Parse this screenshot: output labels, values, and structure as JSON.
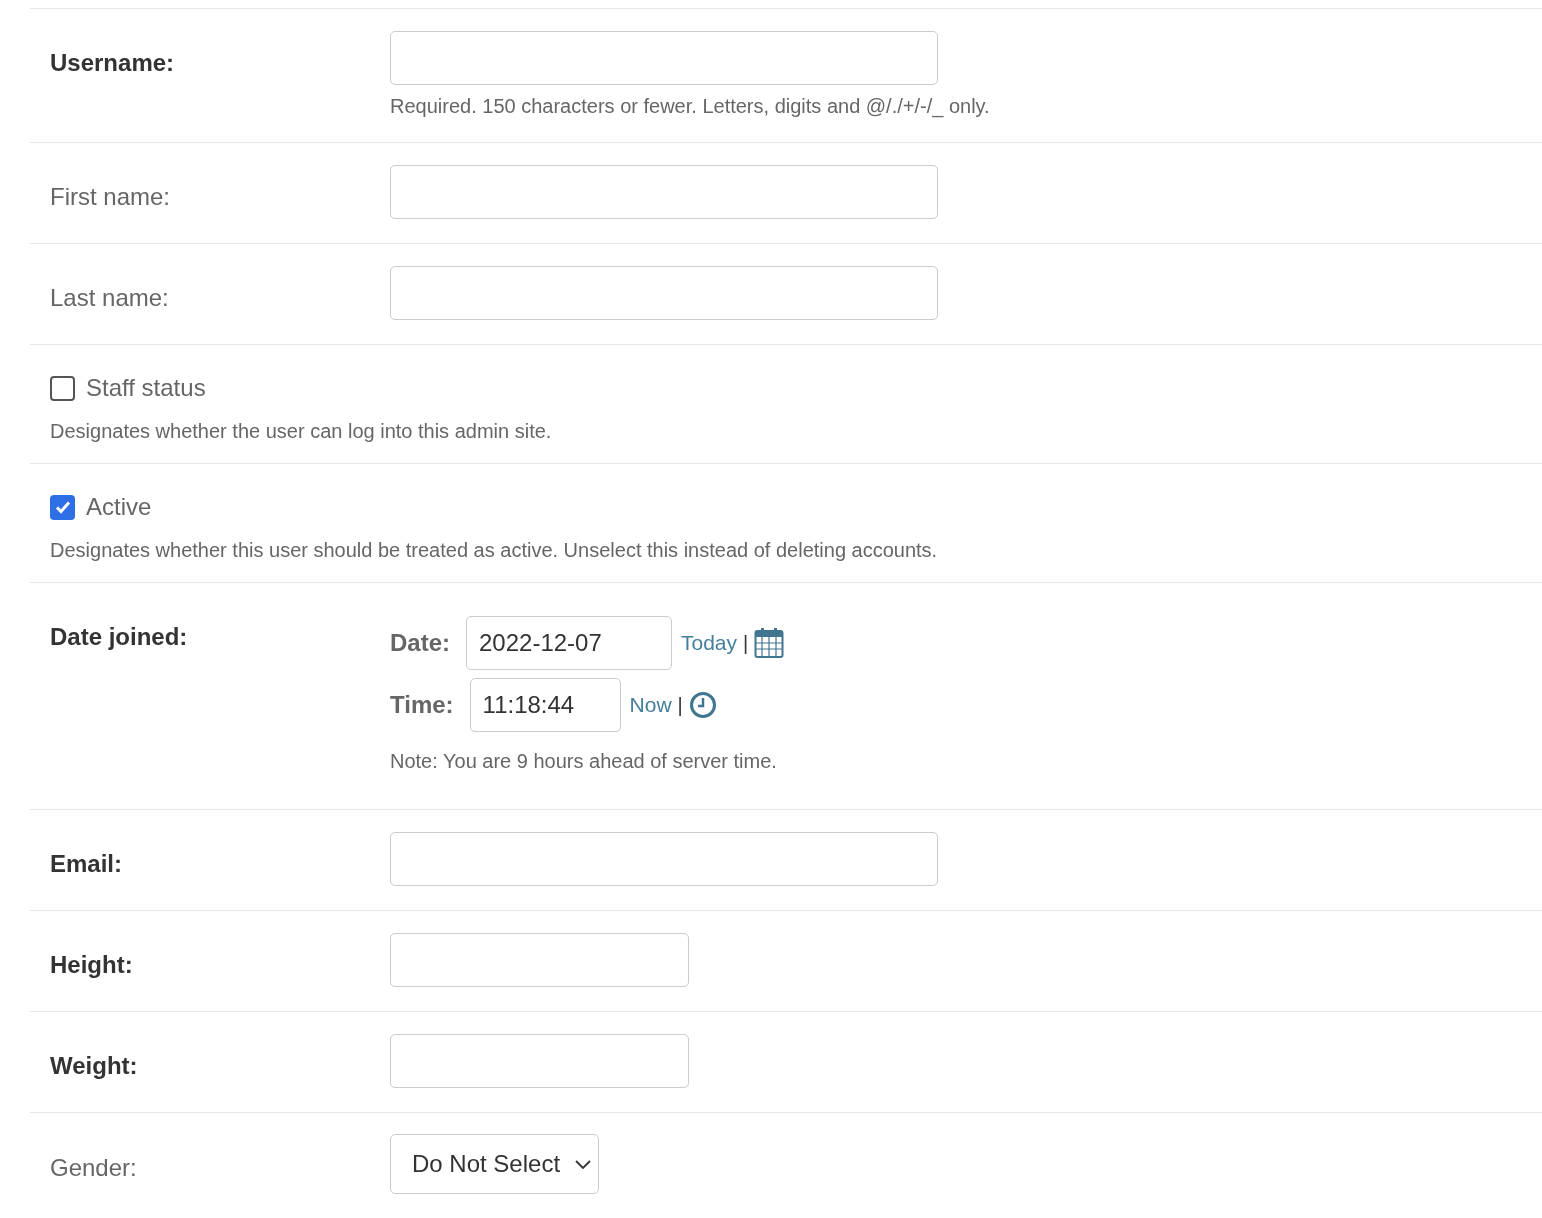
{
  "fields": [
    {
      "kind": "text",
      "label": "Username:",
      "required": true,
      "help": "Required. 150 characters or fewer. Letters, digits and @/./+/-/_ only."
    },
    {
      "kind": "text",
      "label": "First name:",
      "required": false
    },
    {
      "kind": "text",
      "label": "Last name:",
      "required": false
    },
    {
      "kind": "checkbox",
      "label": "Staff status",
      "checked": false,
      "help": "Designates whether the user can log into this admin site."
    },
    {
      "kind": "checkbox",
      "label": "Active",
      "checked": true,
      "help": "Designates whether this user should be treated as active. Unselect this instead of deleting accounts."
    },
    {
      "kind": "datetime",
      "label": "Date joined:",
      "required": true,
      "date": {
        "label": "Date:",
        "value": "2022-12-07",
        "link": "Today",
        "separator": "|"
      },
      "time": {
        "label": "Time:",
        "value": "11:18:44",
        "link": "Now",
        "separator": "|"
      },
      "note": "Note: You are 9 hours ahead of server time."
    },
    {
      "kind": "text",
      "label": "Email:",
      "required": true
    },
    {
      "kind": "number",
      "label": "Height:",
      "required": true
    },
    {
      "kind": "number",
      "label": "Weight:",
      "required": true
    },
    {
      "kind": "select",
      "label": "Gender:",
      "required": false,
      "value": "Do Not Select"
    }
  ]
}
